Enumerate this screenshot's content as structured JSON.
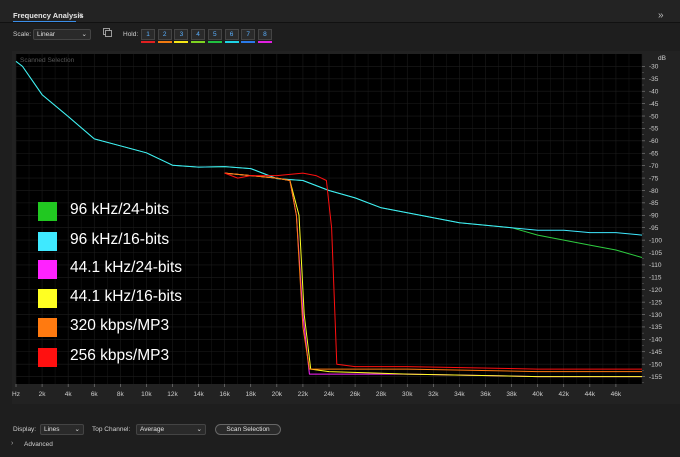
{
  "panel": {
    "title": "Frequency Analysis",
    "menu_icon": "hamburger-icon",
    "close_icon": "double-chevron-icon"
  },
  "toolbar": {
    "scale_label": "Scale:",
    "scale_value": "Linear",
    "hold_label": "Hold:",
    "hold_buttons": [
      {
        "label": "1",
        "color": "#e02020"
      },
      {
        "label": "2",
        "color": "#f07a10"
      },
      {
        "label": "3",
        "color": "#f5e616"
      },
      {
        "label": "4",
        "color": "#7ed321"
      },
      {
        "label": "5",
        "color": "#20c040"
      },
      {
        "label": "6",
        "color": "#1ed3e6"
      },
      {
        "label": "7",
        "color": "#2a7ae8"
      },
      {
        "label": "8",
        "color": "#e020e0"
      }
    ]
  },
  "chart_overlay_label": "Scanned Selection",
  "legend": [
    {
      "label": "96 kHz/24-bits",
      "color": "#21c821"
    },
    {
      "label": "96 kHz/16-bits",
      "color": "#3fe9ff"
    },
    {
      "label": "44.1 kHz/24-bits",
      "color": "#ff22ff"
    },
    {
      "label": "44.1 kHz/16-bits",
      "color": "#ffff22"
    },
    {
      "label": "320 kbps/MP3",
      "color": "#ff7a10"
    },
    {
      "label": "256 kbps/MP3",
      "color": "#ff1010"
    }
  ],
  "chart_data": {
    "type": "line",
    "xlabel": "",
    "ylabel": "",
    "x_unit": "Hz",
    "x_ticks": [
      "Hz",
      "2k",
      "4k",
      "6k",
      "8k",
      "10k",
      "12k",
      "14k",
      "16k",
      "18k",
      "20k",
      "22k",
      "24k",
      "26k",
      "28k",
      "30k",
      "32k",
      "34k",
      "36k",
      "38k",
      "40k",
      "42k",
      "44k",
      "46k"
    ],
    "xlim": [
      0,
      48000
    ],
    "y_unit": "dB",
    "y_ticks": [
      "-30",
      "-35",
      "-40",
      "-45",
      "-50",
      "-55",
      "-60",
      "-65",
      "-70",
      "-75",
      "-80",
      "-85",
      "-90",
      "-95",
      "-100",
      "-105",
      "-110",
      "-115",
      "-120",
      "-125",
      "-130",
      "-135",
      "-140",
      "-145",
      "-150",
      "-155"
    ],
    "ylim": [
      -158,
      -25
    ],
    "grid": true,
    "series": [
      {
        "name": "96 kHz/24-bits",
        "color": "#2ecc40",
        "x": [
          0,
          500,
          2000,
          4000,
          6000,
          8000,
          10000,
          12000,
          14000,
          16000,
          18000,
          20000,
          22000,
          24000,
          26000,
          28000,
          30000,
          32000,
          34000,
          36000,
          38000,
          40000,
          42000,
          44000,
          46000,
          48000
        ],
        "y": [
          -28,
          -30,
          -42,
          -52,
          -58,
          -62,
          -66,
          -68,
          -70,
          -71,
          -73,
          -74,
          -76,
          -80,
          -83,
          -87,
          -89,
          -91,
          -93,
          -94,
          -95,
          -98,
          -100,
          -102,
          -104,
          -107
        ]
      },
      {
        "name": "96 kHz/16-bits",
        "color": "#3fe9ff",
        "x": [
          0,
          500,
          2000,
          4000,
          6000,
          8000,
          10000,
          12000,
          14000,
          16000,
          18000,
          20000,
          22000,
          24000,
          26000,
          28000,
          30000,
          32000,
          34000,
          36000,
          38000,
          40000,
          42000,
          44000,
          46000,
          48000
        ],
        "y": [
          -28,
          -30,
          -42,
          -52,
          -58,
          -62,
          -66,
          -68,
          -70,
          -71,
          -73,
          -74,
          -76,
          -80,
          -83,
          -87,
          -89,
          -91,
          -93,
          -94,
          -95,
          -96,
          -96,
          -97,
          -97,
          -98
        ]
      },
      {
        "name": "44.1 kHz/24-bits",
        "color": "#ff22ff",
        "x": [
          16000,
          18000,
          20000,
          21000,
          21500,
          22000,
          22500,
          24000,
          30000,
          40000,
          48000
        ],
        "y": [
          -73,
          -74,
          -75,
          -76,
          -90,
          -130,
          -154,
          -154,
          -154,
          -155,
          -155
        ]
      },
      {
        "name": "44.1 kHz/16-bits",
        "color": "#ffff22",
        "x": [
          16000,
          18000,
          20000,
          21000,
          21700,
          22100,
          22600,
          24000,
          30000,
          40000,
          48000
        ],
        "y": [
          -73,
          -74,
          -75,
          -76,
          -90,
          -130,
          -152,
          -153,
          -154,
          -155,
          -155
        ]
      },
      {
        "name": "320 kbps/MP3",
        "color": "#ff7a10",
        "x": [
          16000,
          18000,
          20000,
          21000,
          21500,
          22000,
          22500,
          24000,
          30000,
          40000,
          48000
        ],
        "y": [
          -73,
          -74,
          -75,
          -76,
          -90,
          -135,
          -152,
          -152,
          -152,
          -153,
          -153
        ]
      },
      {
        "name": "256 kbps/MP3",
        "color": "#ff1010",
        "x": [
          16000,
          17000,
          18000,
          20000,
          22000,
          23000,
          23800,
          24200,
          24600,
          26000,
          30000,
          40000,
          48000
        ],
        "y": [
          -73,
          -75,
          -74,
          -74,
          -73,
          -74,
          -76,
          -95,
          -150,
          -151,
          -151,
          -152,
          -152
        ]
      }
    ]
  },
  "footer": {
    "display_label": "Display:",
    "display_value": "Lines",
    "top_channel_label": "Top Channel:",
    "top_channel_value": "Average",
    "scan_button": "Scan Selection",
    "advanced_label": "Advanced"
  }
}
